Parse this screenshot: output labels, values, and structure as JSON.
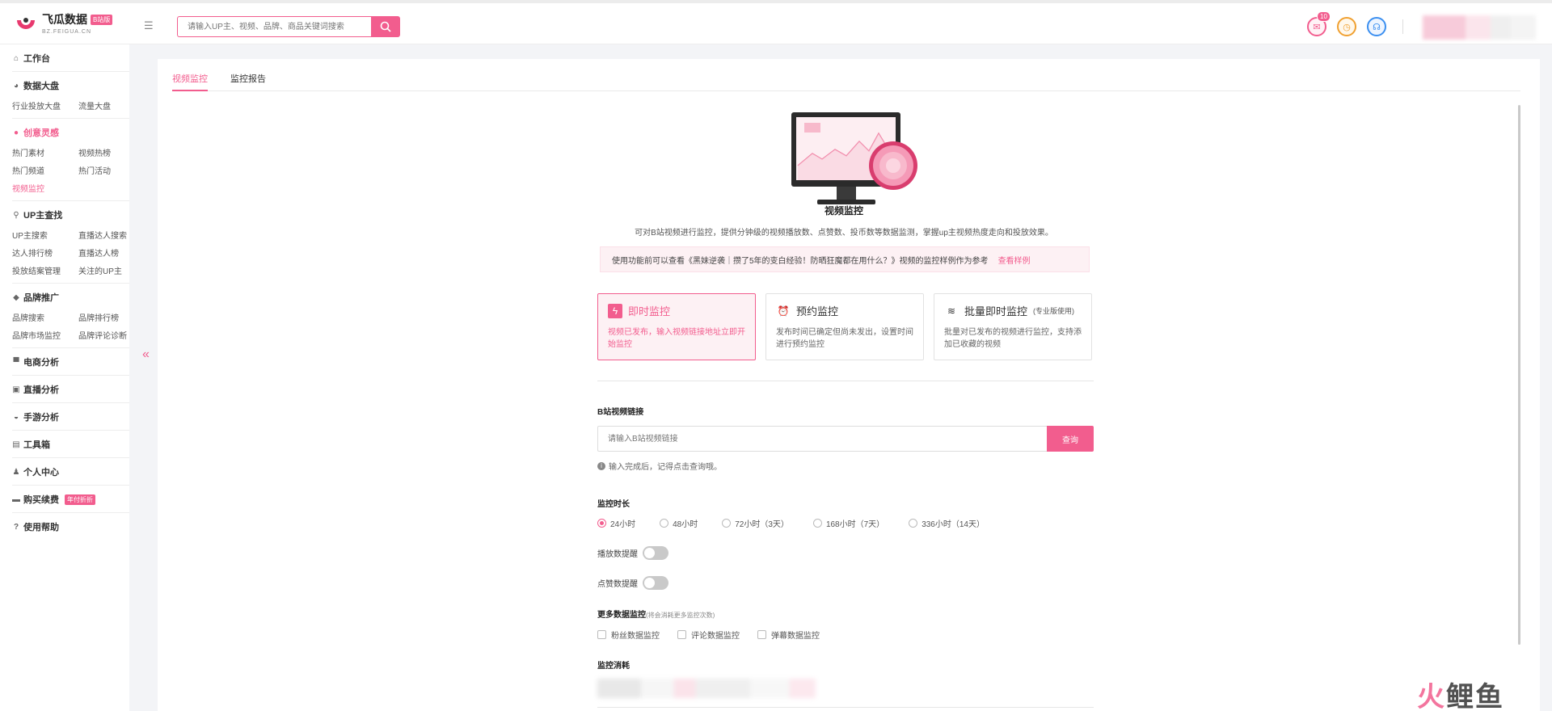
{
  "brand": {
    "name": "飞瓜数据",
    "badge": "B站版",
    "domain": "BZ.FEIGUA.CN",
    "color": "#f25d8e"
  },
  "header": {
    "search_placeholder": "请输入UP主、视频、品牌、商品关键词搜索",
    "message_count": "10",
    "icons": [
      "mail-icon",
      "clock-icon",
      "headset-icon"
    ]
  },
  "sidebar": {
    "groups": [
      {
        "icon": "home-icon",
        "title": "工作台",
        "links": []
      },
      {
        "icon": "chart-icon",
        "title": "数据大盘",
        "links": [
          "行业投放大盘",
          "流量大盘"
        ]
      },
      {
        "icon": "bulb-icon",
        "title": "创意灵感",
        "active": true,
        "links": [
          "热门素材",
          "视频热榜",
          "热门频道",
          "热门活动",
          "视频监控"
        ]
      },
      {
        "icon": "search-icon",
        "title": "UP主查找",
        "links": [
          "UP主搜索",
          "直播达人搜索",
          "达人排行榜",
          "直播达人榜",
          "投放结案管理",
          "关注的UP主"
        ]
      },
      {
        "icon": "diamond-icon",
        "title": "品牌推广",
        "links": [
          "品牌搜索",
          "品牌排行榜",
          "品牌市场监控",
          "品牌评论诊断"
        ]
      },
      {
        "icon": "cart-icon",
        "title": "电商分析",
        "links": []
      },
      {
        "icon": "tv-icon",
        "title": "直播分析",
        "links": []
      },
      {
        "icon": "gamepad-icon",
        "title": "手游分析",
        "links": []
      },
      {
        "icon": "toolbox-icon",
        "title": "工具箱",
        "links": []
      },
      {
        "icon": "user-icon",
        "title": "个人中心",
        "links": []
      },
      {
        "icon": "card-icon",
        "title": "购买续费",
        "promo": "年付折折",
        "links": []
      },
      {
        "icon": "question-icon",
        "title": "使用帮助",
        "links": []
      }
    ],
    "active_link": "视频监控"
  },
  "tabs": [
    "视频监控",
    "监控报告"
  ],
  "active_tab": "视频监控",
  "intro": {
    "title": "视频监控",
    "description": "可对B站视频进行监控，提供分钟级的视频播放数、点赞数、投币数等数据监测，掌握up主视频热度走向和投放效果。",
    "notice": "使用功能前可以查看《黑妹逆袭｜攒了5年的变白经验！防晒狂魔都在用什么？》视频的监控样例作为参考",
    "notice_link": "查看样例"
  },
  "modes": [
    {
      "icon": "lightning-icon",
      "title": "即时监控",
      "note": "",
      "desc": "视频已发布，输入视频链接地址立即开始监控",
      "active": true
    },
    {
      "icon": "alarm-clock-icon",
      "title": "预约监控",
      "note": "",
      "desc": "发布时间已确定但尚未发出，设置时间进行预约监控",
      "active": false
    },
    {
      "icon": "layers-icon",
      "title": "批量即时监控",
      "note": "(专业版使用)",
      "desc": "批量对已发布的视频进行监控，支持添加已收藏的视频",
      "active": false
    }
  ],
  "form": {
    "url_label": "B站视频链接",
    "url_placeholder": "请输入B站视频链接",
    "query_button": "查询",
    "hint": "输入完成后，记得点击查询哦。",
    "duration_label": "监控时长",
    "durations": [
      "24小时",
      "48小时",
      "72小时（3天）",
      "168小时（7天）",
      "336小时（14天）"
    ],
    "selected_duration": "24小时",
    "play_alert_label": "播放数提醒",
    "like_alert_label": "点赞数提醒",
    "more_label": "更多数据监控",
    "more_sub": "(将会消耗更多监控次数)",
    "more_options": [
      "粉丝数据监控",
      "评论数据监控",
      "弹幕数据监控"
    ],
    "cost_label": "监控消耗"
  },
  "watermark": {
    "part1": "火",
    "part2": "鲤鱼"
  }
}
